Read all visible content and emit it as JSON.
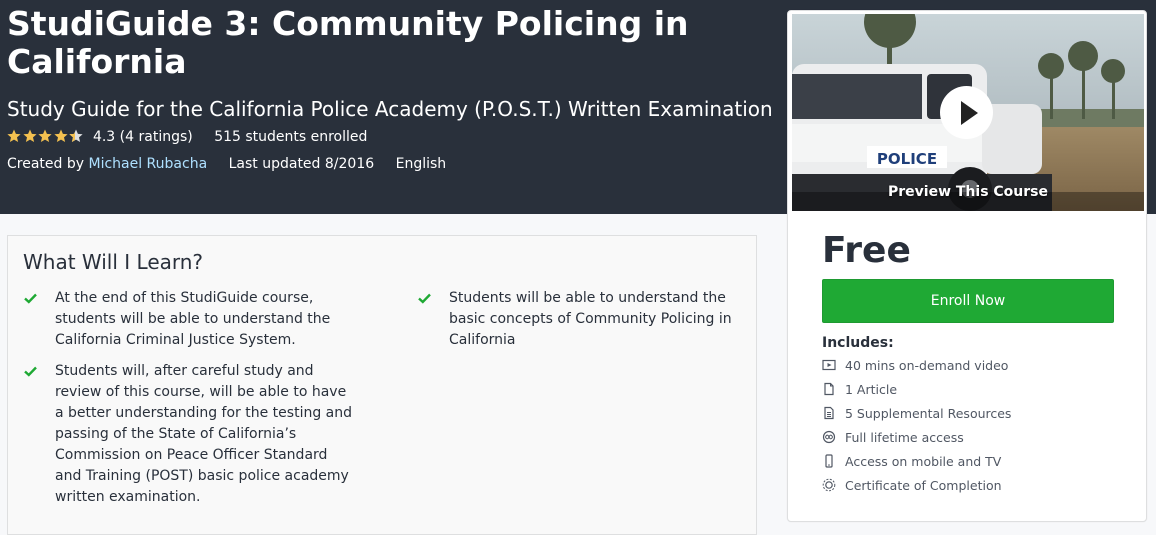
{
  "course": {
    "title": "StudiGuide 3: Community Policing in California",
    "subtitle": "Study Guide for the California Police Academy (P.O.S.T.) Written Examination",
    "rating_value": "4.3",
    "rating_count": "(4 ratings)",
    "stars": 4.3,
    "enrolled": "515 students enrolled",
    "created_by_label": "Created by",
    "author": "Michael Rubacha",
    "last_updated": "Last updated 8/2016",
    "language": "English"
  },
  "learn": {
    "heading": "What Will I Learn?",
    "objectives": [
      "At the end of this StudiGuide course, students will be able to understand the California Criminal Justice System.",
      "Students will be able to understand the basic concepts of Community Policing in California",
      "Students will, after careful study and review of this course, will be able to have a better understanding for the testing and passing of the State of California’s Commission on Peace Officer Standard and Training (POST) basic police academy written examination."
    ]
  },
  "sidebar": {
    "preview_label": "Preview This Course",
    "price": "Free",
    "enroll_label": "Enroll Now",
    "includes_title": "Includes:",
    "includes": [
      {
        "icon": "video-icon",
        "label": "40 mins on-demand video"
      },
      {
        "icon": "article-icon",
        "label": "1 Article"
      },
      {
        "icon": "resources-icon",
        "label": "5 Supplemental Resources"
      },
      {
        "icon": "infinity-icon",
        "label": "Full lifetime access"
      },
      {
        "icon": "mobile-icon",
        "label": "Access on mobile and TV"
      },
      {
        "icon": "certificate-icon",
        "label": "Certificate of Completion"
      }
    ],
    "colors": {
      "enroll": "#1fa934",
      "header_bg": "#29303b",
      "star": "#f4c150",
      "check": "#1fa934"
    }
  }
}
